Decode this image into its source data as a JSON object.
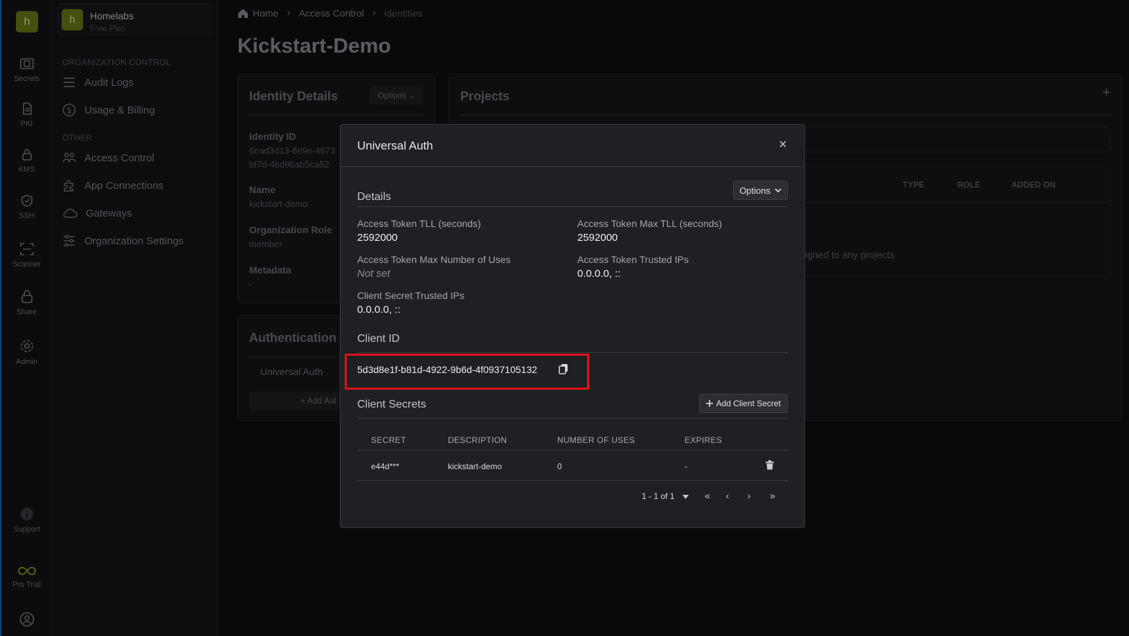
{
  "rail": {
    "logo": "h",
    "items": [
      {
        "label": "Secrets",
        "icon": "vault-icon"
      },
      {
        "label": "PKI",
        "icon": "document-icon"
      },
      {
        "label": "KMS",
        "icon": "lock-key-icon"
      },
      {
        "label": "SSH",
        "icon": "shield-icon"
      },
      {
        "label": "Scanner",
        "icon": "scan-icon"
      },
      {
        "label": "Share",
        "icon": "lock-icon"
      },
      {
        "label": "Admin",
        "icon": "gear-icon"
      },
      {
        "label": "Support",
        "icon": "info-icon"
      },
      {
        "label": "Pro Trial",
        "icon": "infinity-icon"
      }
    ]
  },
  "sidebar": {
    "org_badge": "h",
    "org_name": "Homelabs",
    "org_plan": "Free Plan",
    "section_org": "ORGANIZATION CONTROL",
    "org_items": [
      {
        "label": "Audit Logs"
      },
      {
        "label": "Usage & Billing"
      }
    ],
    "section_other": "OTHER",
    "other_items": [
      {
        "label": "Access Control"
      },
      {
        "label": "App Connections"
      },
      {
        "label": "Gateways"
      },
      {
        "label": "Organization Settings"
      }
    ]
  },
  "breadcrumb": {
    "home": "Home",
    "access_control": "Access Control",
    "current": "identities"
  },
  "page_title": "Kickstart-Demo",
  "identity_card": {
    "title": "Identity Details",
    "options_label": "Options",
    "identity_id_label": "Identity ID",
    "identity_id_line1": "6ead3d13-8e9e-4673",
    "identity_id_line2": "bf7d-4bd96ab5ca52",
    "name_label": "Name",
    "name_value": "kickstart-demo",
    "role_label": "Organization Role",
    "role_value": "member",
    "metadata_label": "Metadata",
    "metadata_value": "-"
  },
  "auth_card": {
    "title": "Authentication",
    "method": "Universal Auth",
    "add_label": "+ Add Aut"
  },
  "projects_card": {
    "title": "Projects",
    "add_icon": "+",
    "col_type": "TYPE",
    "col_role": "ROLE",
    "col_added_on": "ADDED ON",
    "empty_text": "signed to any projects"
  },
  "modal": {
    "title": "Universal Auth",
    "close_icon": "×",
    "details_title": "Details",
    "options_label": "Options",
    "fields": {
      "ttl_label": "Access Token TLL (seconds)",
      "ttl_value": "2592000",
      "max_ttl_label": "Access Token Max TLL (seconds)",
      "max_ttl_value": "2592000",
      "max_uses_label": "Access Token Max Number of Uses",
      "max_uses_value": "Not set",
      "trusted_ips_label": "Access Token Trusted IPs",
      "trusted_ips_value": "0.0.0.0, ::",
      "secret_ips_label": "Client Secret Trusted IPs",
      "secret_ips_value": "0.0.0.0, ::"
    },
    "client_id_title": "Client ID",
    "client_id": "5d3d8e1f-b81d-4922-9b6d-4f0937105132",
    "client_secrets_title": "Client Secrets",
    "add_secret_label": "Add Client Secret",
    "table": {
      "headers": [
        "SECRET",
        "DESCRIPTION",
        "NUMBER OF USES",
        "EXPIRES"
      ],
      "rows": [
        {
          "secret": "e44d***",
          "description": "kickstart-demo",
          "uses": "0",
          "expires": "-"
        }
      ]
    },
    "pagination": {
      "range": "1 - 1 of 1",
      "first": "«",
      "prev": "‹",
      "next": "›",
      "last": "»"
    }
  },
  "colors": {
    "brand": "#6b7a16",
    "highlight": "#e0111a",
    "modal_bg": "#1f2023"
  }
}
